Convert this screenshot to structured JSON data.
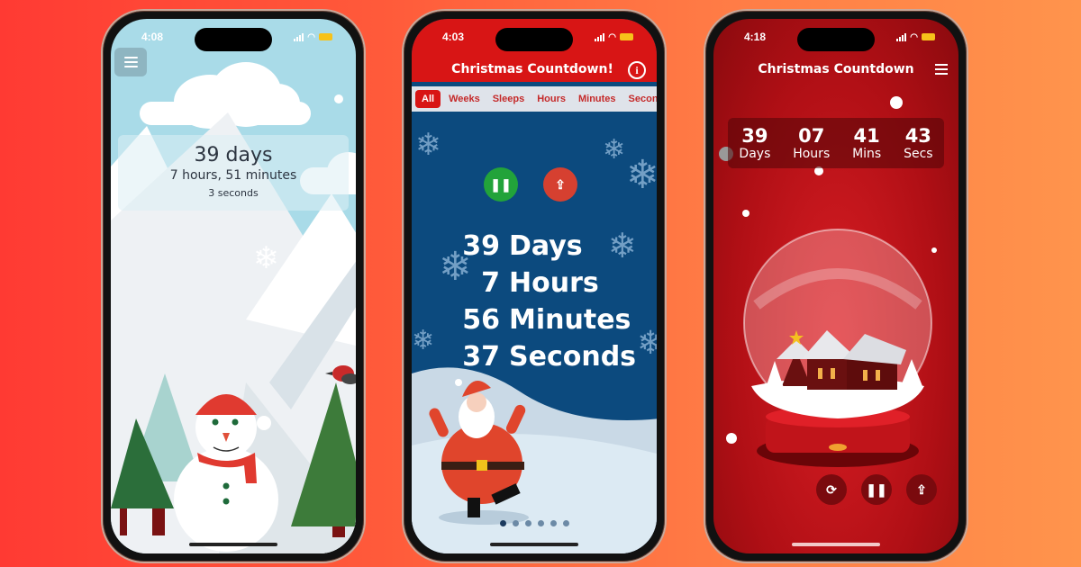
{
  "phones": [
    {
      "status_time": "4:08",
      "countdown": {
        "days": "39 days",
        "hours_minutes": "7 hours, 51 minutes",
        "seconds": "3 seconds"
      },
      "icons": {
        "menu": "hamburger-menu-icon"
      },
      "theme": {
        "sky": "#a9dbe8"
      }
    },
    {
      "status_time": "4:03",
      "title": "Christmas Countdown!",
      "info_icon": "i",
      "tabs": [
        "All",
        "Weeks",
        "Sleeps",
        "Hours",
        "Minutes",
        "Seconds"
      ],
      "active_tab": "All",
      "buttons": {
        "pause": "❚❚",
        "share": "⇪"
      },
      "rows": [
        {
          "num": "39",
          "unit": "Days"
        },
        {
          "num": "7",
          "unit": "Hours"
        },
        {
          "num": "56",
          "unit": "Minutes"
        },
        {
          "num": "37",
          "unit": "Seconds"
        }
      ],
      "page_dots": {
        "count": 6,
        "active": 1
      },
      "theme": {
        "header": "#d81515",
        "background": "#0c4a7e",
        "pause": "#22a33a",
        "share": "#d64030"
      }
    },
    {
      "status_time": "4:18",
      "title": "Christmas Countdown",
      "timer": [
        {
          "value": "39",
          "label": "Days"
        },
        {
          "value": "07",
          "label": "Hours"
        },
        {
          "value": "41",
          "label": "Mins"
        },
        {
          "value": "43",
          "label": "Secs"
        }
      ],
      "controls": {
        "switch": "⟳",
        "pause": "❚❚",
        "share": "⇪"
      },
      "theme": {
        "background": "#b00f15"
      }
    }
  ]
}
